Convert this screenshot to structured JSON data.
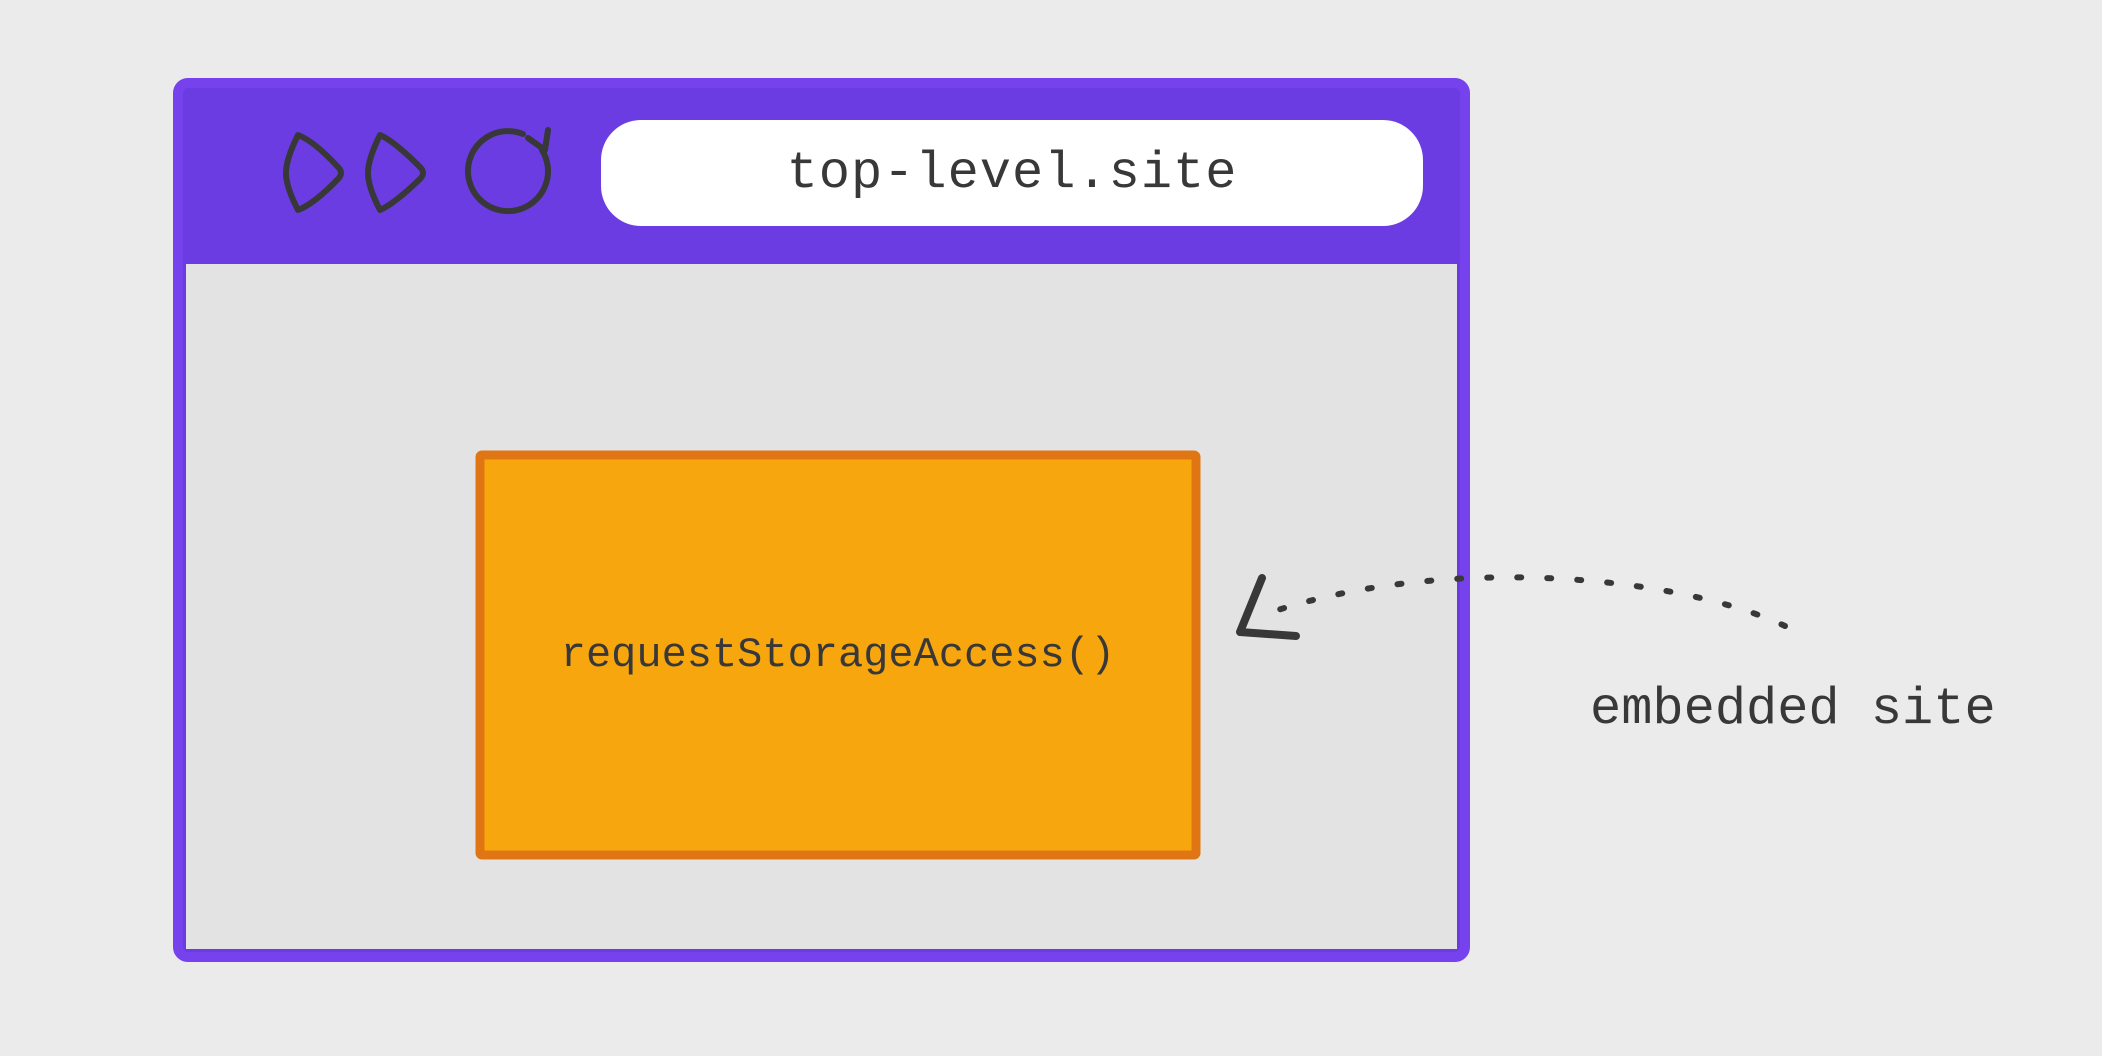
{
  "browser": {
    "address_bar": "top-level.site",
    "embedded": {
      "api_call": "requestStorageAccess()"
    }
  },
  "annotation": {
    "label": "embedded site"
  },
  "colors": {
    "background": "#ebebeb",
    "browser_frame": "#6c3ce3",
    "browser_border": "#7542ed",
    "content_bg": "#e3e3e3",
    "address_bar_bg": "#ffffff",
    "embedded_fill": "#f7a60e",
    "embedded_stroke": "#e07513",
    "ink": "#383838"
  }
}
